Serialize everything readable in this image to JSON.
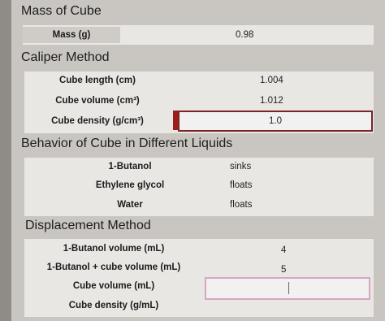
{
  "sections": {
    "mass_heading": "Mass of Cube",
    "caliper_heading": "Caliper Method",
    "behavior_heading": "Behavior of Cube in Different Liquids",
    "displacement_heading": "Displacement Method"
  },
  "mass": {
    "label": "Mass (g)",
    "value": "0.98"
  },
  "caliper": {
    "length_label": "Cube length (cm)",
    "length_value": "1.004",
    "volume_label": "Cube volume (cm³)",
    "volume_value": "1.012",
    "density_label": "Cube density (g/cm³)",
    "density_value": "1.0"
  },
  "behavior": {
    "rows": [
      {
        "label": "1-Butanol",
        "value": "sinks"
      },
      {
        "label": "Ethylene glycol",
        "value": "floats"
      },
      {
        "label": "Water",
        "value": "floats"
      }
    ]
  },
  "displacement": {
    "butanol_volume_label": "1-Butanol volume (mL)",
    "butanol_volume_value": "4",
    "butanol_cube_label": "1-Butanol + cube volume (mL)",
    "butanol_cube_value": "5",
    "cube_volume_label": "Cube volume (mL)",
    "cube_volume_value": "",
    "cube_density_label": "Cube density (g/mL)"
  },
  "colors": {
    "background": "#c9c6c1",
    "panel": "#e9e7e4",
    "accent_red": "#9b1d1d",
    "focus_pink": "#d6a6c2"
  }
}
